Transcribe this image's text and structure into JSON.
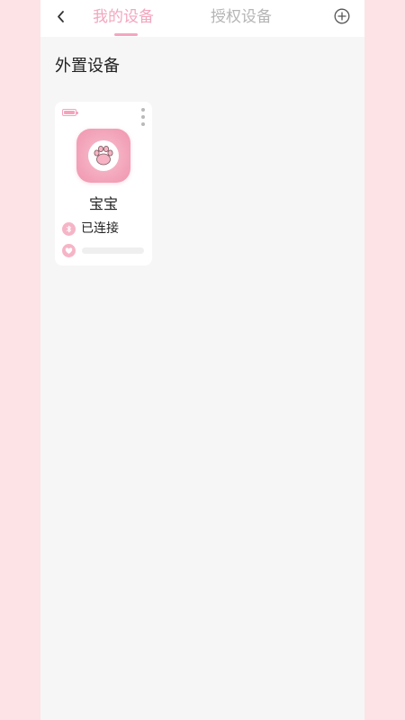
{
  "header": {
    "back_icon": "chevron-left-icon",
    "tabs": [
      {
        "label": "我的设备",
        "active": true
      },
      {
        "label": "授权设备",
        "active": false
      }
    ],
    "add_icon": "plus-circle-icon"
  },
  "section": {
    "title": "外置设备"
  },
  "devices": [
    {
      "name": "宝宝",
      "avatar_icon": "cat-paw-icon",
      "battery_icon": "battery-icon",
      "battery_level": 1.0,
      "more_icon": "more-vertical-icon",
      "status_icon": "bluetooth-icon",
      "status": "已连接",
      "strength_icon": "heart-icon",
      "strength_level": 0.0
    }
  ],
  "colors": {
    "accent": "#f3a6be",
    "inactive_tab": "#b5b5b5",
    "background": "#f6f6f6",
    "outer_background": "#fde3e5",
    "card": "#ffffff"
  }
}
